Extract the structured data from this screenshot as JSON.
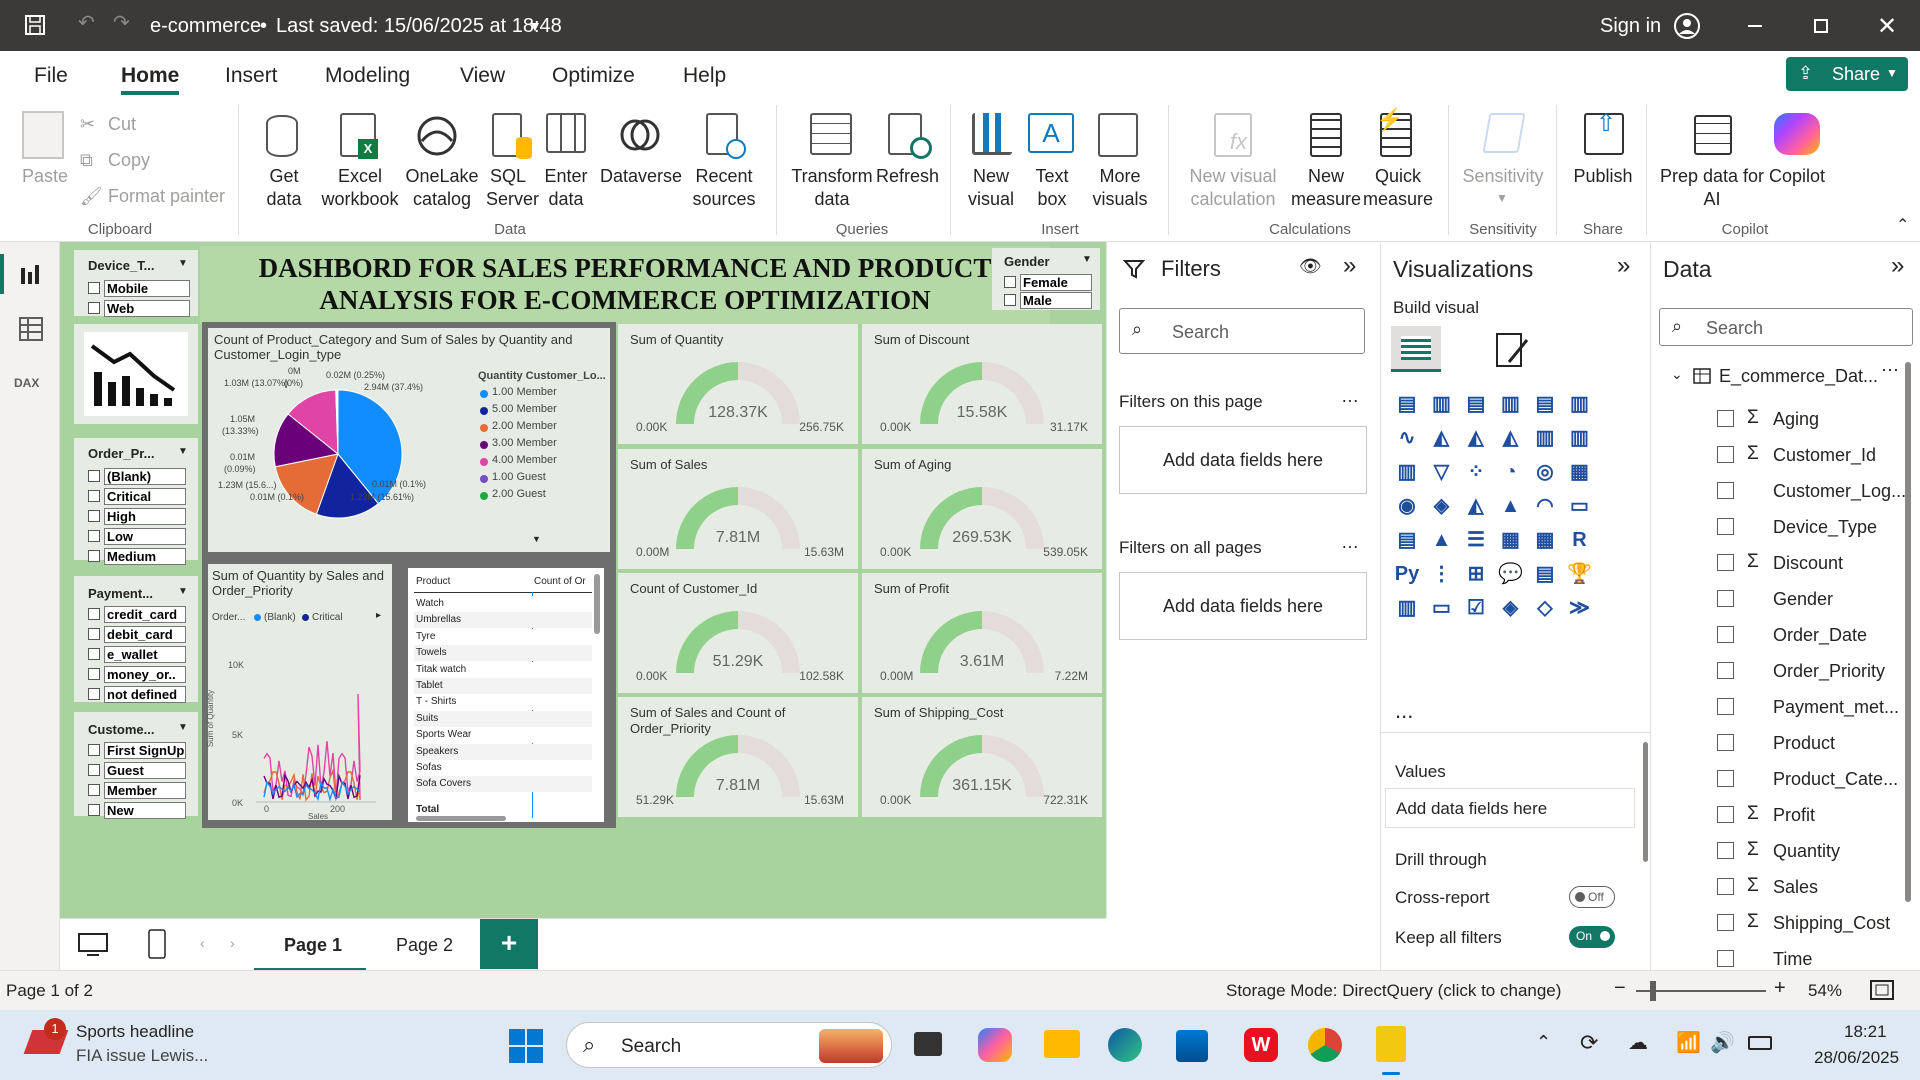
{
  "titlebar": {
    "file_title": "e-commerce",
    "saved": "Last saved: 15/06/2025 at 18:48",
    "sign_in": "Sign in"
  },
  "menu": [
    "File",
    "Home",
    "Insert",
    "Modeling",
    "View",
    "Optimize",
    "Help"
  ],
  "share": "Share",
  "ribbon": {
    "clipboard": {
      "paste": "Paste",
      "cut": "Cut",
      "copy": "Copy",
      "format_painter": "Format painter",
      "group": "Clipboard"
    },
    "data": {
      "get": "Get data",
      "excel": "Excel workbook",
      "onelake": "OneLake catalog",
      "sql": "SQL Server",
      "enter": "Enter data",
      "dataverse": "Dataverse",
      "recent": "Recent sources",
      "group": "Data"
    },
    "queries": {
      "transform": "Transform data",
      "refresh": "Refresh",
      "group": "Queries"
    },
    "insert": {
      "new_visual": "New visual",
      "text_box": "Text box",
      "more_visuals": "More visuals",
      "group": "Insert"
    },
    "calc": {
      "new_visual_calc": "New visual calculation",
      "new_measure": "New measure",
      "quick_measure": "Quick measure",
      "group": "Calculations"
    },
    "sens": {
      "label": "Sensitivity",
      "group": "Sensitivity"
    },
    "share": {
      "publish": "Publish",
      "group": "Share"
    },
    "copilot": {
      "prep": "Prep data for AI",
      "copilot": "Copilot",
      "group": "Copilot"
    }
  },
  "dashboard": {
    "title": "DASHBORD FOR SALES PERFORMANCE AND PRODUCT ANALYSIS FOR E-COMMERCE OPTIMIZATION",
    "device_slicer": {
      "header": "Device_T...",
      "items": [
        "Mobile",
        "Web"
      ]
    },
    "gender_slicer": {
      "header": "Gender",
      "items": [
        "Female",
        "Male"
      ]
    },
    "order_slicer": {
      "header": "Order_Pr...",
      "items": [
        "(Blank)",
        "Critical",
        "High",
        "Low",
        "Medium"
      ]
    },
    "payment_slicer": {
      "header": "Payment...",
      "items": [
        "credit_card",
        "debit_card",
        "e_wallet",
        "money_or..",
        "not defined"
      ]
    },
    "customer_slicer": {
      "header": "Custome...",
      "items": [
        "First SignUp",
        "Guest",
        "Member",
        "New"
      ]
    },
    "pie": {
      "title": "Count of Product_Category and Sum of Sales by Quantity and Customer_Login_type",
      "legend_title": "Quantity Customer_Lo...",
      "legend": [
        {
          "label": "1.00 Member",
          "color": "#118dff"
        },
        {
          "label": "5.00 Member",
          "color": "#12239e"
        },
        {
          "label": "2.00 Member",
          "color": "#e66c37"
        },
        {
          "label": "3.00 Member",
          "color": "#6b007b"
        },
        {
          "label": "4.00 Member",
          "color": "#e044a7"
        },
        {
          "label": "1.00 Guest",
          "color": "#744ec2"
        },
        {
          "label": "2.00 Guest",
          "color": "#1aab40"
        }
      ],
      "labels": {
        "l1": "0M",
        "l2": "0.02M (0.25%)",
        "l3": "1.03M (13.07%)",
        "l4": "(0%)",
        "l5": "2.94M (37.4%)",
        "l6": "1.05M",
        "l7": "(13.33%)",
        "l8": "0.01M",
        "l9": "(0.09%)",
        "l10": "1.23M (15.6...)",
        "l11": "0.01M (0.1%)",
        "l12": "0.01M (0.1%)",
        "l13": "1.23M (15.61%)"
      }
    },
    "line": {
      "title": "Sum of Quantity by Sales and Order_Priority",
      "legend_head": "Order...",
      "legend": [
        "(Blank)",
        "Critical"
      ],
      "ylabel": "Sum of Quantity",
      "xlabel": "Sales",
      "yticks": [
        "10K",
        "5K",
        "0K"
      ],
      "xticks": [
        "0",
        "200"
      ]
    },
    "table": {
      "headers": [
        "Product",
        "Count of Or"
      ],
      "rows": [
        "Watch",
        "Umbrellas",
        "Tyre",
        "Towels",
        "Titak watch",
        "Tablet",
        "T - Shirts",
        "Suits",
        "Sports Wear",
        "Speakers",
        "Sofas",
        "Sofa Covers"
      ],
      "total": "Total"
    },
    "gauges": [
      {
        "title": "Sum of Quantity",
        "value": "128.37K",
        "min": "0.00K",
        "max": "256.75K",
        "fraction": 0.5
      },
      {
        "title": "Sum of Discount",
        "value": "15.58K",
        "min": "0.00K",
        "max": "31.17K",
        "fraction": 0.5
      },
      {
        "title": "Sum of Sales",
        "value": "7.81M",
        "min": "0.00M",
        "max": "15.63M",
        "fraction": 0.5
      },
      {
        "title": "Sum of Aging",
        "value": "269.53K",
        "min": "0.00K",
        "max": "539.05K",
        "fraction": 0.5
      },
      {
        "title": "Count of Customer_Id",
        "value": "51.29K",
        "min": "0.00K",
        "max": "102.58K",
        "fraction": 0.5
      },
      {
        "title": "Sum of Profit",
        "value": "3.61M",
        "min": "0.00M",
        "max": "7.22M",
        "fraction": 0.5
      },
      {
        "title": "Sum of Sales and Count of Order_Priority",
        "value": "7.81M",
        "min": "51.29K",
        "max": "15.63M",
        "fraction": 0.5
      },
      {
        "title": "Sum of Shipping_Cost",
        "value": "361.15K",
        "min": "0.00K",
        "max": "722.31K",
        "fraction": 0.5
      }
    ]
  },
  "filters": {
    "title": "Filters",
    "search": "Search",
    "on_page": "Filters on this page",
    "add": "Add data fields here",
    "all_pages": "Filters on all pages"
  },
  "viz": {
    "title": "Visualizations",
    "build": "Build visual",
    "values": "Values",
    "add": "Add data fields here",
    "drill": "Drill through",
    "cross": "Cross-report",
    "off": "Off",
    "keep": "Keep all filters",
    "on": "On",
    "more": "..."
  },
  "data": {
    "title": "Data",
    "search": "Search",
    "table": "E_commerce_Dat...",
    "fields": [
      {
        "name": "Aging",
        "sigma": true
      },
      {
        "name": "Customer_Id",
        "sigma": true
      },
      {
        "name": "Customer_Log...",
        "sigma": false
      },
      {
        "name": "Device_Type",
        "sigma": false
      },
      {
        "name": "Discount",
        "sigma": true
      },
      {
        "name": "Gender",
        "sigma": false
      },
      {
        "name": "Order_Date",
        "sigma": false
      },
      {
        "name": "Order_Priority",
        "sigma": false
      },
      {
        "name": "Payment_met...",
        "sigma": false
      },
      {
        "name": "Product",
        "sigma": false
      },
      {
        "name": "Product_Cate...",
        "sigma": false
      },
      {
        "name": "Profit",
        "sigma": true
      },
      {
        "name": "Quantity",
        "sigma": true
      },
      {
        "name": "Sales",
        "sigma": true
      },
      {
        "name": "Shipping_Cost",
        "sigma": true
      },
      {
        "name": "Time",
        "sigma": false
      }
    ]
  },
  "tabs": [
    "Page 1",
    "Page 2"
  ],
  "status": {
    "page": "Page 1 of 2",
    "storage": "Storage Mode: DirectQuery (click to change)",
    "zoom": "54%"
  },
  "taskbar": {
    "news_title": "Sports headline",
    "news_sub": "FIA issue Lewis...",
    "search": "Search",
    "time": "18:21",
    "date": "28/06/2025",
    "badge": "1"
  }
}
